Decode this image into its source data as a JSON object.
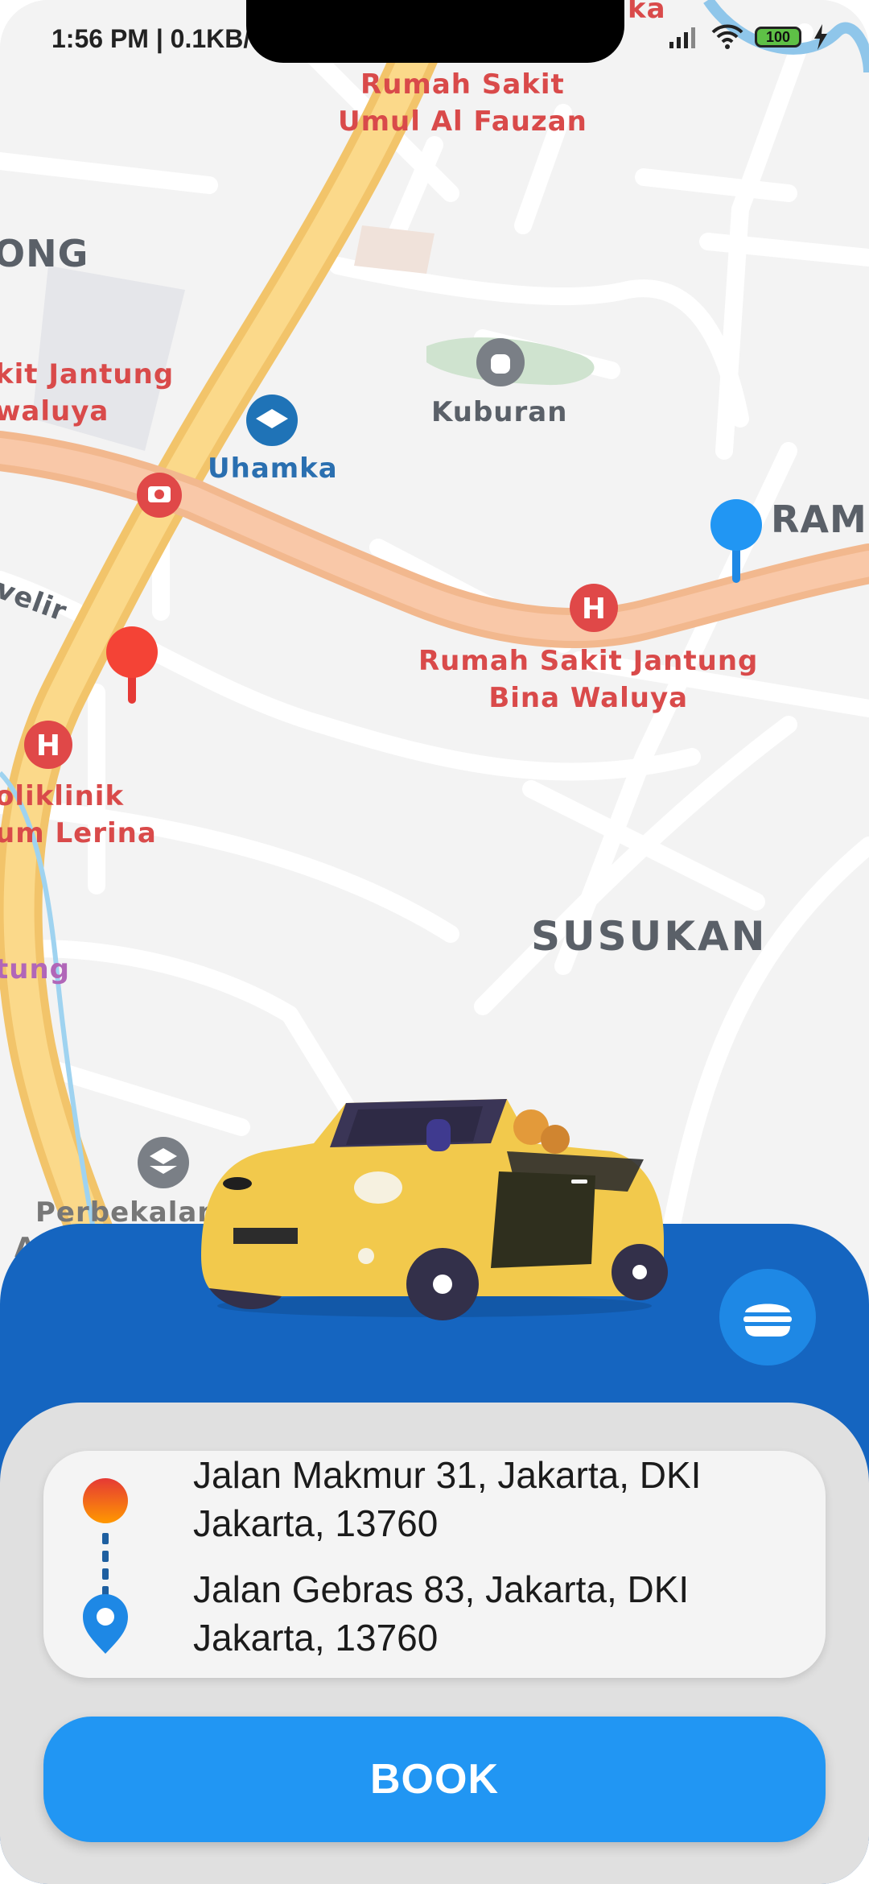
{
  "status_bar": {
    "time": "1:56 PM | 0.1KB/",
    "battery": "100"
  },
  "map": {
    "labels": {
      "rs_umul": "Rumah Sakit\nUmul Al Fauzan",
      "ong": "ONG",
      "kit_jantung": "kit Jantung\nwaluya",
      "kuburan": "Kuburan",
      "uhamka": "Uhamka",
      "ram": "RAM",
      "velir": "velir",
      "rs_jantung": "Rumah Sakit Jantung\nBina Waluya",
      "poliklinik": "oliklinik\num Lerina",
      "susukan": "SUSUKAN",
      "tung": "tung",
      "perbekalan": "Perbekalan",
      "a": "A",
      "ka": "ka"
    }
  },
  "route": {
    "origin": "Jalan Makmur 31, Jakarta, DKI Jakarta, 13760",
    "destination": "Jalan Gebras 83, Jakarta, DKI Jakarta, 13760"
  },
  "actions": {
    "book_label": "BOOK"
  },
  "colors": {
    "panel_blue": "#1565c0",
    "accent_blue": "#2196f3",
    "pin_red": "#f44336",
    "pin_blue": "#2196f3",
    "car_yellow": "#f2c94c"
  }
}
